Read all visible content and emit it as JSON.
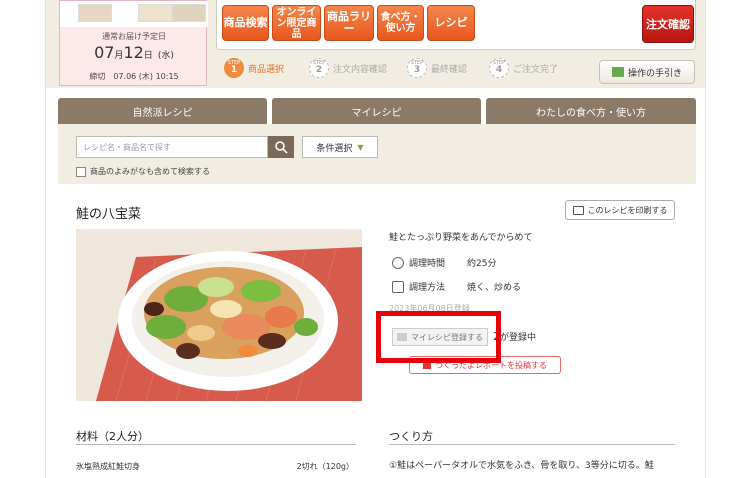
{
  "delivery": {
    "label": "通常お届け予定日",
    "date_month": "07",
    "date_month_unit": "月",
    "date_day": "12",
    "date_day_unit": "日",
    "date_weekday": "(水)",
    "deadline": "締切　07.06 (木) 10:15"
  },
  "nav": {
    "buttons": [
      "商品検索",
      "オンライン限定商品",
      "商品ラリー",
      "食べ方・使い方",
      "レシピ"
    ],
    "order_button": "注文確認"
  },
  "steps": [
    {
      "prefix": "STEP",
      "num": "1",
      "label": "商品選択"
    },
    {
      "prefix": "STEP",
      "num": "2",
      "label": "注文内容確認"
    },
    {
      "prefix": "STEP",
      "num": "3",
      "label": "最終確認"
    },
    {
      "prefix": "STEP",
      "num": "4",
      "label": "ご注文完了"
    }
  ],
  "guide_button": "操作の手引き",
  "tabs": [
    "自然派レシピ",
    "マイレシピ",
    "わたしの食べ方・使い方"
  ],
  "search": {
    "placeholder": "レシピ名・商品名で探す",
    "condition_button": "条件選択",
    "checkbox_label": "商品のよみがなも含めて検索する"
  },
  "recipe": {
    "title": "鮭の八宝菜",
    "print_button": "このレシピを印刷する",
    "description": "鮭とたっぷり野菜をあんでからめて",
    "cook_time_label": "調理時間",
    "cook_time_value": "約25分",
    "cook_method_label": "調理方法",
    "cook_method_value": "焼く、炒める",
    "registered_date": "2023年06月08日登録",
    "myrecipe_button": "マイレシピ登録する",
    "reg_count": "2",
    "reg_suffix": "が登録中",
    "report_button": "つくったよレポートを投稿する"
  },
  "ingredients": {
    "title": "材料（2人分）",
    "items": [
      {
        "name": "氷塩熟成紅鮭切身",
        "amount": "2切れ（120g）"
      }
    ]
  },
  "method": {
    "title": "つくり方",
    "steps": [
      "①鮭はペーパータオルで水気をふき、骨を取り、3等分に切る。鮭"
    ]
  }
}
